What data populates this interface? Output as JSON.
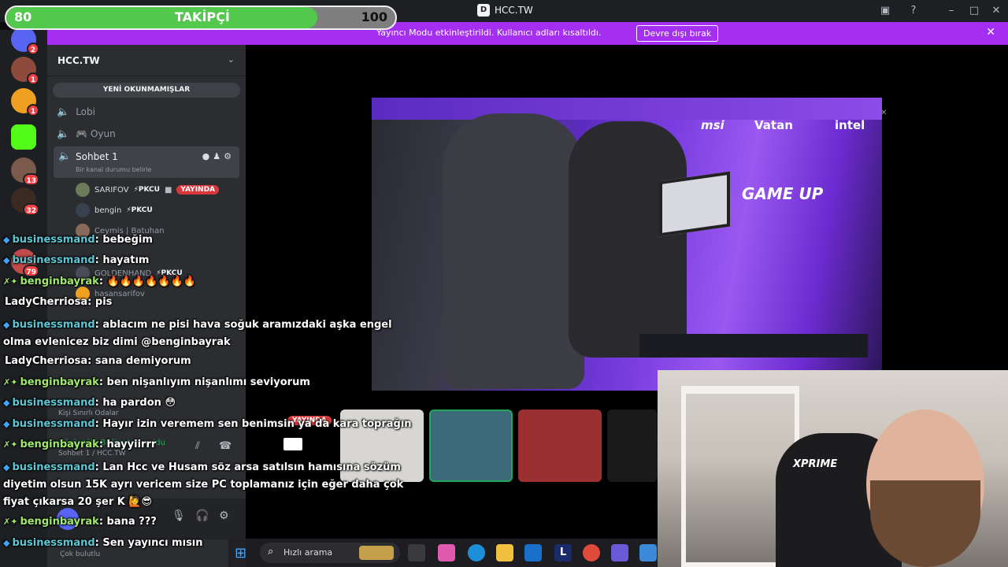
{
  "window": {
    "title": "HCC.TW",
    "controls": [
      "inbox-icon",
      "help-icon",
      "minimize-icon",
      "maximize-icon",
      "close-icon"
    ]
  },
  "follower_goal": {
    "current": "80",
    "label": "TAKİPÇİ",
    "goal": "100",
    "progress": 0.8,
    "fill_color": "#52c84c"
  },
  "notice": {
    "text": "Yayıncı Modu etkinleştirildi. Kullanıcı adları kısaltıldı.",
    "button": "Devre dışı bırak",
    "color": "#a52ff0"
  },
  "servers": [
    {
      "badge": "2"
    },
    {
      "badge": "1"
    },
    {
      "badge": "1"
    },
    {
      "badge": ""
    },
    {
      "badge": "13"
    },
    {
      "badge": "32"
    },
    {
      "badge": "79"
    }
  ],
  "sidebar": {
    "server_name": "HCC.TW",
    "unread_label": "YENİ OKUNMAMIŞLAR",
    "channels": [
      {
        "name": "Lobi"
      },
      {
        "name": "🎮 Oyun"
      }
    ],
    "active_channel": {
      "name": "Sohbet 1",
      "status": "Bir kanal durumu belirle"
    },
    "members": [
      {
        "name": "SARIFOV",
        "tag": "⚡PKCU",
        "badge": "YAYINDA"
      },
      {
        "name": "bengin",
        "tag": "⚡PKCU",
        "badge": ""
      },
      {
        "name": "Ceymis | Batuhan",
        "tag": "",
        "badge": ""
      },
      {
        "name": "GOLDENHAND",
        "tag": "⚡PKCU",
        "badge": ""
      },
      {
        "name": "hasansarifov",
        "tag": "",
        "badge": ""
      }
    ],
    "voice_rooms_label": "Kişi Sınırlı Odalar",
    "voice_status": {
      "title": "Görüntülü Bağlantı Kuruldu",
      "sub": "Sohbet 1 / HCC.TW"
    },
    "user_status_line": "Çok bulutlu"
  },
  "stream": {
    "sponsors": [
      "msi",
      "Vatan",
      "intel"
    ],
    "brand": "GAME UP",
    "tile_live_badge": "YAYINDA"
  },
  "webcam": {
    "chair_logo": "XPRIME"
  },
  "chat": [
    {
      "user": "businessmand",
      "text": ": bebeğim",
      "badge": "diamond",
      "color": "cyan"
    },
    {
      "user": "businessmand",
      "text": ": hayatım",
      "badge": "diamond",
      "color": "cyan"
    },
    {
      "user": "benginbayrak",
      "text": ": 🔥🔥🔥🔥🔥🔥🔥",
      "badge": "star",
      "color": "green"
    },
    {
      "user": "LadyCherriosa",
      "text": ": pis",
      "badge": "",
      "color": "white"
    },
    {
      "user": "businessmand",
      "text": ": ablacım ne pisi hava soğuk aramızdaki aşka engel olma evlenicez biz dimi @benginbayrak",
      "badge": "diamond",
      "color": "cyan"
    },
    {
      "user": "LadyCherriosa",
      "text": ": sana demiyorum",
      "badge": "",
      "color": "white"
    },
    {
      "user": "benginbayrak",
      "text": ": ben nişanlıyım nişanlımı seviyorum",
      "badge": "star",
      "color": "green"
    },
    {
      "user": "businessmand",
      "text": ": ha pardon 😳",
      "badge": "diamond",
      "color": "cyan"
    },
    {
      "user": "businessmand",
      "text": ": Hayır izin veremem sen benimsin ya da kara toprağın",
      "badge": "diamond",
      "color": "cyan"
    },
    {
      "user": "benginbayrak",
      "text": ": hayyiirrr",
      "badge": "star",
      "color": "green"
    },
    {
      "user": "businessmand",
      "text": ": Lan Hcc ve Husam söz arsa satılsın hamısına sözüm diyetim olsun 15K ayrı vericem size PC toplamanız için eğer daha çok fiyat çıkarsa 20 şer K 🙋😎",
      "badge": "diamond",
      "color": "cyan"
    },
    {
      "user": "benginbayrak",
      "text": ": bana ???",
      "badge": "star",
      "color": "green"
    },
    {
      "user": "businessmand",
      "text": ": Sen yayıncı mısın",
      "badge": "diamond",
      "color": "cyan"
    }
  ],
  "taskbar": {
    "search_placeholder": "Hızlı arama"
  }
}
